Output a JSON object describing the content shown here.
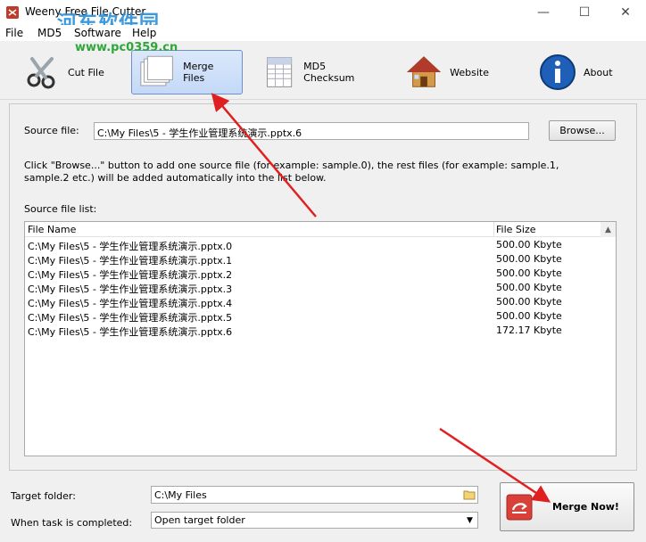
{
  "window": {
    "title": "Weeny Free File Cutter",
    "watermark_logo": "河东软件园",
    "watermark_url": "www.pc0359.cn",
    "controls": {
      "minimize": "—",
      "maximize": "☐",
      "close": "✕"
    }
  },
  "menu": {
    "items": [
      "File",
      "MD5",
      "Software",
      "Help"
    ]
  },
  "toolbar": {
    "cut_file": "Cut File",
    "merge_files": "Merge Files",
    "md5_checksum": "MD5 Checksum",
    "website": "Website",
    "about": "About"
  },
  "source": {
    "label": "Source file:",
    "value": "C:\\My Files\\5 - 学生作业管理系统演示.pptx.6",
    "browse_label": "Browse...",
    "hint": "Click \"Browse...\" button to add one source file (for example: sample.0), the rest files (for example: sample.1, sample.2 etc.) will be added automatically into the list below."
  },
  "list": {
    "label": "Source file list:",
    "columns": [
      "File Name",
      "File Size"
    ],
    "rows": [
      {
        "name": "C:\\My Files\\5 - 学生作业管理系统演示.pptx.0",
        "size": "500.00 Kbyte"
      },
      {
        "name": "C:\\My Files\\5 - 学生作业管理系统演示.pptx.1",
        "size": "500.00 Kbyte"
      },
      {
        "name": "C:\\My Files\\5 - 学生作业管理系统演示.pptx.2",
        "size": "500.00 Kbyte"
      },
      {
        "name": "C:\\My Files\\5 - 学生作业管理系统演示.pptx.3",
        "size": "500.00 Kbyte"
      },
      {
        "name": "C:\\My Files\\5 - 学生作业管理系统演示.pptx.4",
        "size": "500.00 Kbyte"
      },
      {
        "name": "C:\\My Files\\5 - 学生作业管理系统演示.pptx.5",
        "size": "500.00 Kbyte"
      },
      {
        "name": "C:\\My Files\\5 - 学生作业管理系统演示.pptx.6",
        "size": "172.17 Kbyte"
      }
    ]
  },
  "target": {
    "label": "Target folder:",
    "value": "C:\\My Files"
  },
  "completion": {
    "label": "When task is completed:",
    "value": "Open target folder"
  },
  "merge_now": {
    "label": "Merge Now!"
  },
  "colors": {
    "accent": "#2a8fd8",
    "annotation_arrow": "#e02020",
    "active_tab": "#c4d9f7"
  }
}
